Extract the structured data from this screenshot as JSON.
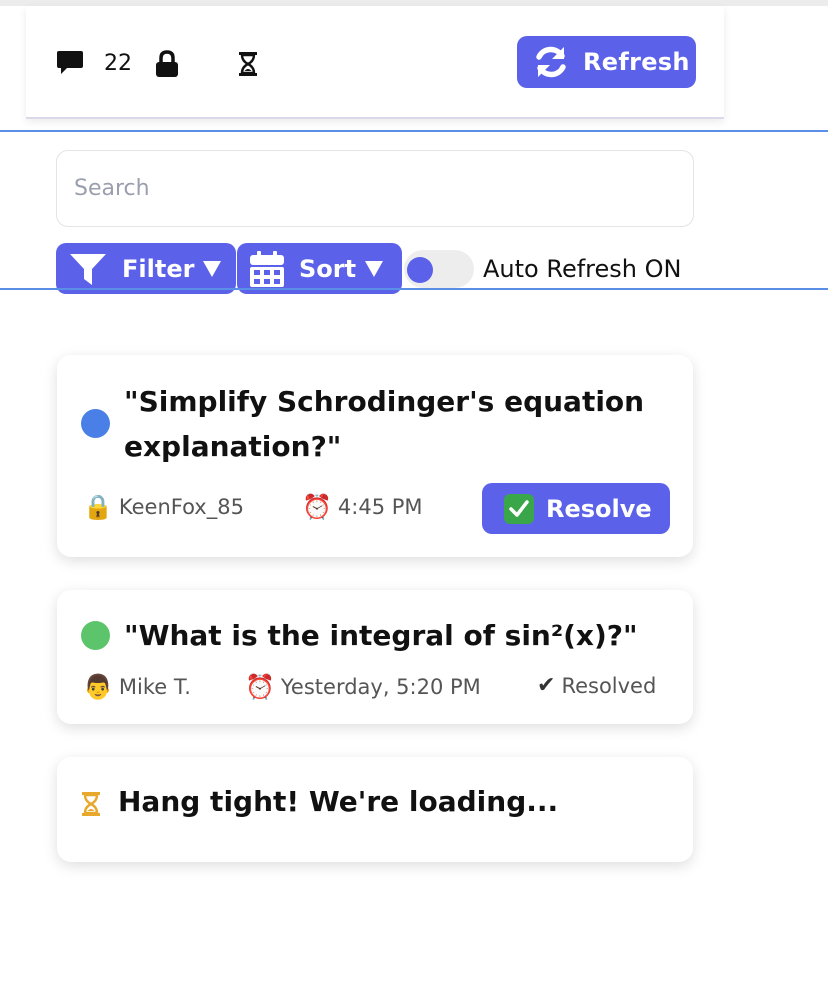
{
  "header": {
    "comment_count": "22",
    "refresh_label": "Refresh",
    "icons": [
      "comment-icon",
      "lock-icon",
      "hourglass-icon",
      "refresh-icon"
    ]
  },
  "search": {
    "placeholder": "Search",
    "value": ""
  },
  "toolbar": {
    "filter_label": "Filter",
    "sort_label": "Sort",
    "auto_refresh_label": "Auto Refresh ON",
    "auto_refresh_on": true
  },
  "questions": [
    {
      "title": "\"Simplify Schrodinger's equation explanation?\"",
      "user_emoji": "🔒",
      "user": "KeenFox_85",
      "time_emoji": "⏰",
      "time": "4:45 PM",
      "status_color": "#4a7fe8",
      "action_label": "Resolve"
    },
    {
      "title": "\"What is the integral of sin²(x)?\"",
      "user_emoji": "👨",
      "user": "Mike T.",
      "time_emoji": "⏰",
      "time": "Yesterday, 5:20 PM",
      "status_color": "#5cc46b",
      "status_mark": "✔",
      "status_label": "Resolved"
    }
  ],
  "loading": {
    "text": "Hang tight! We're loading..."
  },
  "colors": {
    "accent": "#5b61e8",
    "open": "#4a7fe8",
    "resolved": "#5cc46b",
    "loading": "#e8a82c"
  }
}
